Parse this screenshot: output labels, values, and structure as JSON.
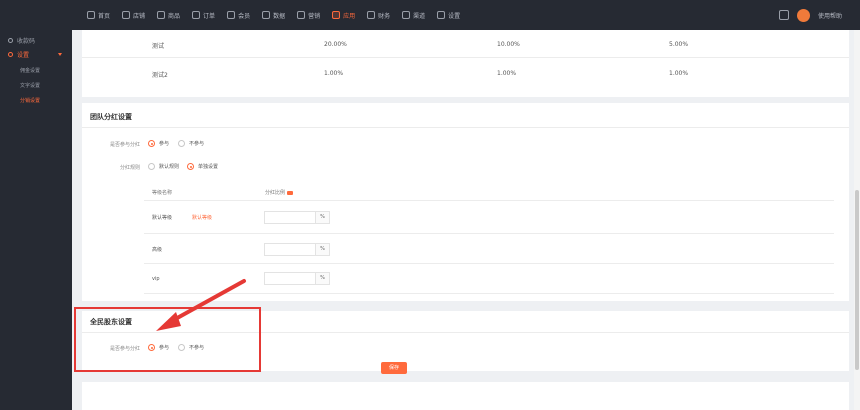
{
  "topnav": {
    "items": [
      {
        "label": "首页",
        "active": false
      },
      {
        "label": "店铺",
        "active": false
      },
      {
        "label": "商品",
        "active": false
      },
      {
        "label": "订单",
        "active": false
      },
      {
        "label": "会员",
        "active": false
      },
      {
        "label": "数据",
        "active": false
      },
      {
        "label": "营销",
        "active": false
      },
      {
        "label": "应用",
        "active": true
      },
      {
        "label": "财务",
        "active": false
      },
      {
        "label": "渠道",
        "active": false
      },
      {
        "label": "设置",
        "active": false
      }
    ],
    "username": "使用帮助"
  },
  "sidebar": {
    "items": [
      {
        "label": "收款码"
      },
      {
        "label": "设置"
      }
    ],
    "subitems": [
      {
        "label": "佣金设置",
        "active": false
      },
      {
        "label": "文字设置",
        "active": false
      },
      {
        "label": "分销设置",
        "active": true
      }
    ]
  },
  "level_table": {
    "rows": [
      {
        "name": "测试",
        "v1": "20.00%",
        "v2": "10.00%",
        "v3": "5.00%"
      },
      {
        "name": "测试2",
        "v1": "1.00%",
        "v2": "1.00%",
        "v3": "1.00%"
      }
    ]
  },
  "team_section": {
    "title": "团队分红设置",
    "participate_label": "是否参与分红",
    "participate_options": [
      "参与",
      "不参与"
    ],
    "rule_label": "分红规则",
    "rule_options": [
      "默认规则",
      "单独设置"
    ],
    "col_level": "等级名称",
    "col_ratio": "分红比例",
    "levels": [
      {
        "name": "默认等级",
        "tag": "默认等级",
        "value": "",
        "unit": "%"
      },
      {
        "name": "高级",
        "tag": "",
        "value": "",
        "unit": "%"
      },
      {
        "name": "vip",
        "tag": "",
        "value": "",
        "unit": "%"
      }
    ]
  },
  "shareholder_section": {
    "title": "全民股东设置",
    "participate_label": "是否参与分红",
    "participate_options": [
      "参与",
      "不参与"
    ]
  },
  "save_label": "保存",
  "colors": {
    "accent": "#ff6a3c",
    "topbar": "#262a33",
    "highlight": "#e53935"
  }
}
